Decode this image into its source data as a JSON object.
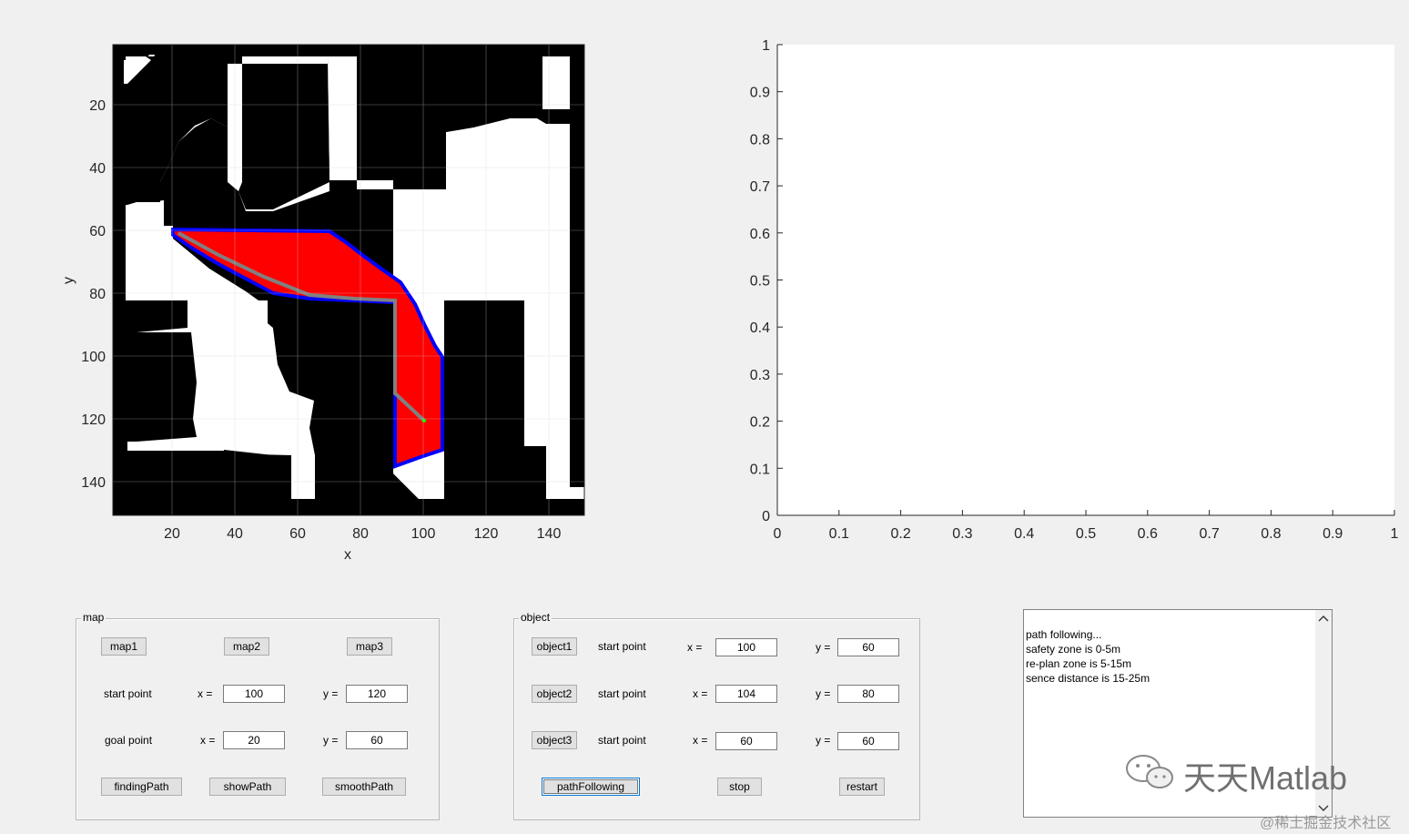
{
  "map_axes": {
    "xlabel": "x",
    "ylabel": "y",
    "x_ticks": [
      "20",
      "40",
      "60",
      "80",
      "100",
      "120",
      "140"
    ],
    "y_ticks": [
      "20",
      "40",
      "60",
      "80",
      "100",
      "120",
      "140"
    ],
    "xlim": [
      1,
      150
    ],
    "ylim": [
      1,
      150
    ],
    "colors": {
      "obstacle": "#000000",
      "free": "#ffffff",
      "zone": "#ff0000",
      "boundary": "#0000ff",
      "path": "#808080",
      "goal": "#00ff00"
    }
  },
  "chart_data": {
    "type": "line",
    "title": "",
    "xlabel": "",
    "ylabel": "",
    "xlim": [
      0,
      1
    ],
    "ylim": [
      0,
      1
    ],
    "x_ticks": [
      "0",
      "0.1",
      "0.2",
      "0.3",
      "0.4",
      "0.5",
      "0.6",
      "0.7",
      "0.8",
      "0.9",
      "1"
    ],
    "y_ticks": [
      "0",
      "0.1",
      "0.2",
      "0.3",
      "0.4",
      "0.5",
      "0.6",
      "0.7",
      "0.8",
      "0.9",
      "1"
    ],
    "series": []
  },
  "map_panel": {
    "title": "map",
    "buttons": {
      "map1": "map1",
      "map2": "map2",
      "map3": "map3",
      "finding": "findingPath",
      "show": "showPath",
      "smooth": "smoothPath"
    },
    "start": {
      "label": "start point",
      "x_label": "x =",
      "x": "100",
      "y_label": "y =",
      "y": "120"
    },
    "goal": {
      "label": "goal point",
      "x_label": "x =",
      "x": "20",
      "y_label": "y =",
      "y": "60"
    }
  },
  "object_panel": {
    "title": "object",
    "rows": [
      {
        "button": "object1",
        "label": "start point",
        "x_label": "x =",
        "x": "100",
        "y_label": "y =",
        "y": "60"
      },
      {
        "button": "object2",
        "label": "start point",
        "x_label": "x =",
        "x": "104",
        "y_label": "y =",
        "y": "80"
      },
      {
        "button": "object3",
        "label": "start point",
        "x_label": "x =",
        "x": "60",
        "y_label": "y =",
        "y": "60"
      }
    ],
    "buttons": {
      "pathFollowing": "pathFollowing",
      "stop": "stop",
      "restart": "restart"
    }
  },
  "log": {
    "lines": [
      "path following...",
      "safety zone is 0-5m",
      "re-plan zone is 5-15m",
      "sence distance is 15-25m"
    ]
  },
  "watermark": {
    "brand": "天天Matlab",
    "site": "@稀土掘金技术社区"
  }
}
